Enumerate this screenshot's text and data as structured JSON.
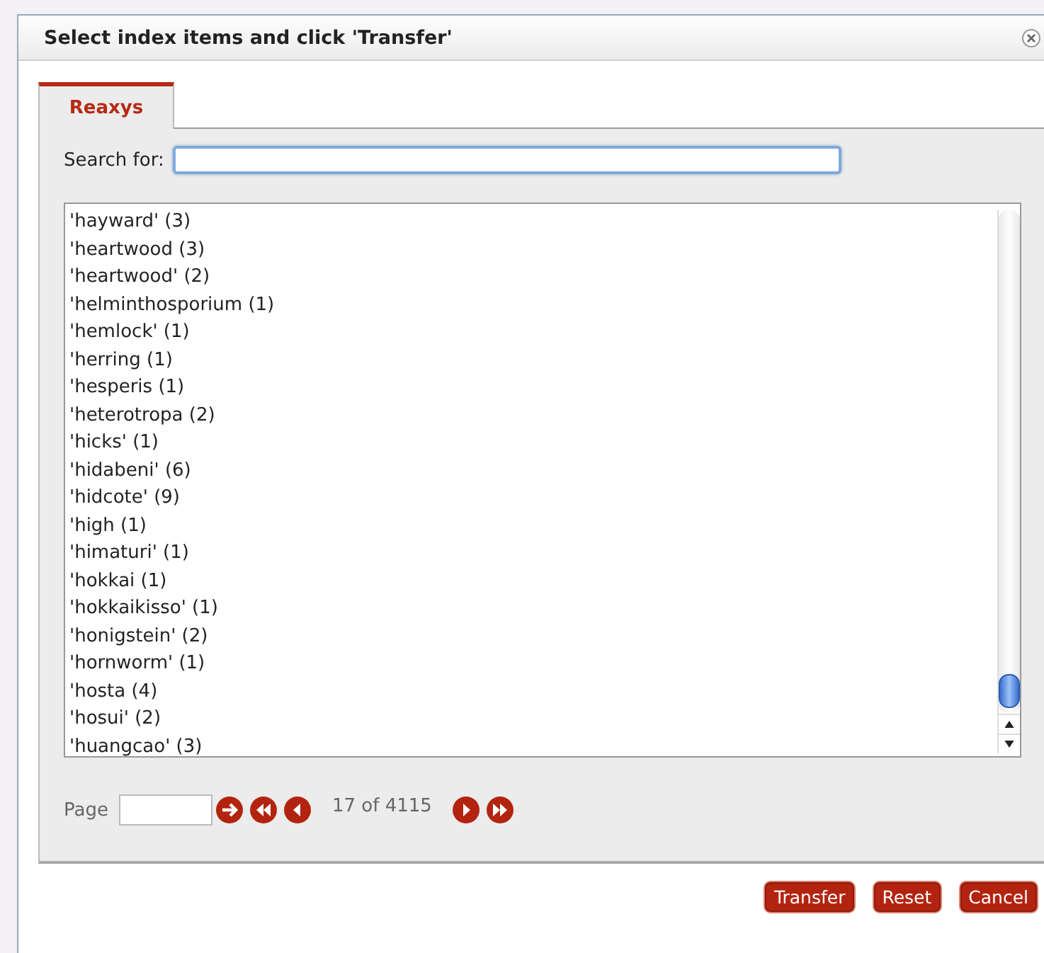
{
  "dialog": {
    "title": "Select index items and click 'Transfer'"
  },
  "tabs": [
    {
      "label": "Reaxys",
      "selected": true
    }
  ],
  "search": {
    "label": "Search for:"
  },
  "items": [
    "'hayward' (3)",
    "'heartwood (3)",
    "'heartwood' (2)",
    "'helminthosporium (1)",
    "'hemlock' (1)",
    "'herring (1)",
    "'hesperis (1)",
    "'heterotropa (2)",
    "'hicks' (1)",
    "'hidabeni' (6)",
    "'hidcote' (9)",
    "'high (1)",
    "'himaturi' (1)",
    "'hokkai (1)",
    "'hokkaikisso' (1)",
    "'honigstein' (2)",
    "'hornworm' (1)",
    "'hosta (4)",
    "'hosui' (2)",
    "'huangcao' (3)"
  ],
  "pager": {
    "label": "Page",
    "status": "17 of 4115",
    "controls": [
      {
        "kind": "go"
      },
      {
        "kind": "first"
      },
      {
        "kind": "prev"
      },
      {
        "kind": "next"
      },
      {
        "kind": "last"
      }
    ]
  },
  "buttons": [
    "Transfer",
    "Reset",
    "Cancel"
  ]
}
